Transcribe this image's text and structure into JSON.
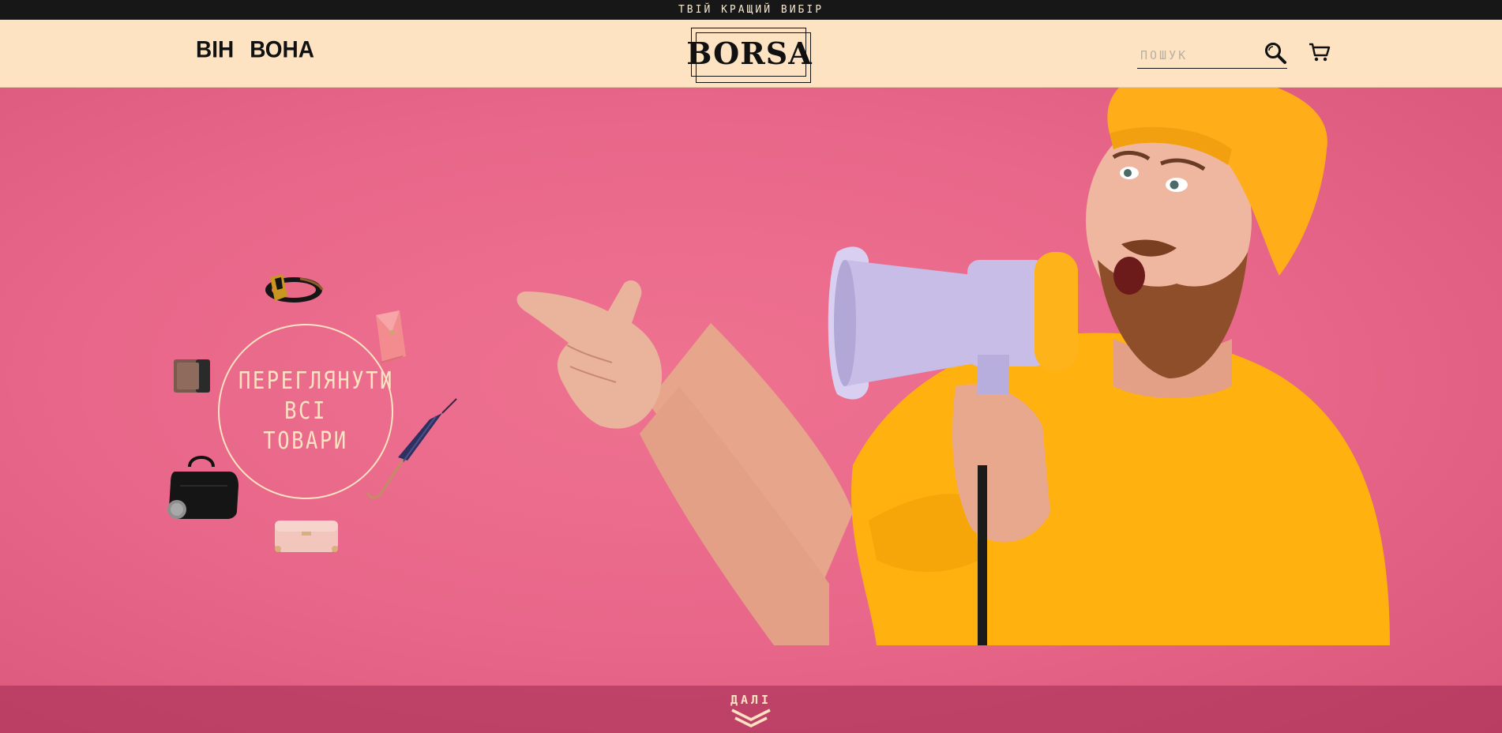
{
  "topbar": {
    "tagline": "ТВІЙ КРАЩИЙ ВИБІР"
  },
  "header": {
    "nav": [
      {
        "label": "ВІН"
      },
      {
        "label": "ВОНА"
      }
    ],
    "logo": "BORSA",
    "search": {
      "placeholder": "ПОШУК",
      "value": ""
    },
    "icons": {
      "search": "search-icon",
      "cart": "cart-icon"
    }
  },
  "hero": {
    "cta": "ПЕРЕГЛЯНУТИ\nВСІ\nТОВАРИ",
    "products": [
      {
        "name": "belt"
      },
      {
        "name": "pink-wallet"
      },
      {
        "name": "brown-wallet"
      },
      {
        "name": "umbrella"
      },
      {
        "name": "black-bag"
      },
      {
        "name": "beige-bag"
      }
    ]
  },
  "footer": {
    "next_label": "ДАЛІ",
    "next_icon": "double-chevron-down-icon"
  },
  "colors": {
    "topbar_bg": "#171717",
    "header_bg": "#fde3c1",
    "hero_bg": "#e96a86",
    "accent_yellow": "#ffb10f",
    "megaphone": "#c7bde6"
  }
}
